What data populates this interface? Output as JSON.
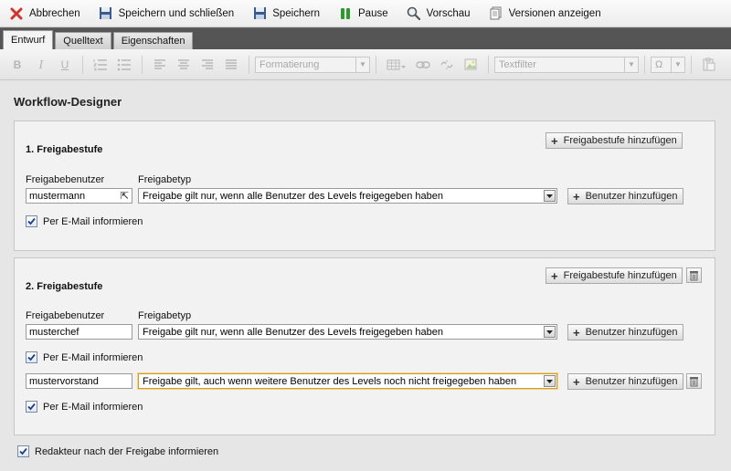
{
  "actions": {
    "cancel": "Abbrechen",
    "save_close": "Speichern und schließen",
    "save": "Speichern",
    "pause": "Pause",
    "preview": "Vorschau",
    "versions": "Versionen anzeigen"
  },
  "tabs": [
    "Entwurf",
    "Quelltext",
    "Eigenschaften"
  ],
  "toolbar": {
    "format_placeholder": "Formatierung",
    "textfilter_placeholder": "Textfilter",
    "omega": "Ω"
  },
  "page_title": "Workflow-Designer",
  "levels": [
    {
      "title": "1. Freigabestufe",
      "add_level_label": "Freigabestufe hinzufügen",
      "user_label": "Freigabebenutzer",
      "type_label": "Freigabetyp",
      "add_user_label": "Benutzer hinzufügen",
      "rows": [
        {
          "user": "mustermann",
          "type": "Freigabe gilt nur, wenn alle Benutzer des Levels freigegeben haben",
          "email_label": "Per E-Mail informieren",
          "email_checked": true
        }
      ]
    },
    {
      "title": "2. Freigabestufe",
      "add_level_label": "Freigabestufe hinzufügen",
      "user_label": "Freigabebenutzer",
      "type_label": "Freigabetyp",
      "add_user_label": "Benutzer hinzufügen",
      "rows": [
        {
          "user": "musterchef",
          "type": "Freigabe gilt nur, wenn alle Benutzer des Levels freigegeben haben",
          "email_label": "Per E-Mail informieren",
          "email_checked": true
        },
        {
          "user": "mustervorstand",
          "type": "Freigabe gilt, auch wenn weitere Benutzer des Levels noch nicht freigegeben haben",
          "email_label": "Per E-Mail informieren",
          "email_checked": true
        }
      ]
    }
  ],
  "footer_check": {
    "label": "Redakteur nach der Freigabe informieren",
    "checked": true
  },
  "colors": {
    "cancel_red": "#d0342c",
    "pause_green": "#2e9a2e",
    "focus_border": "#d19a2e"
  }
}
